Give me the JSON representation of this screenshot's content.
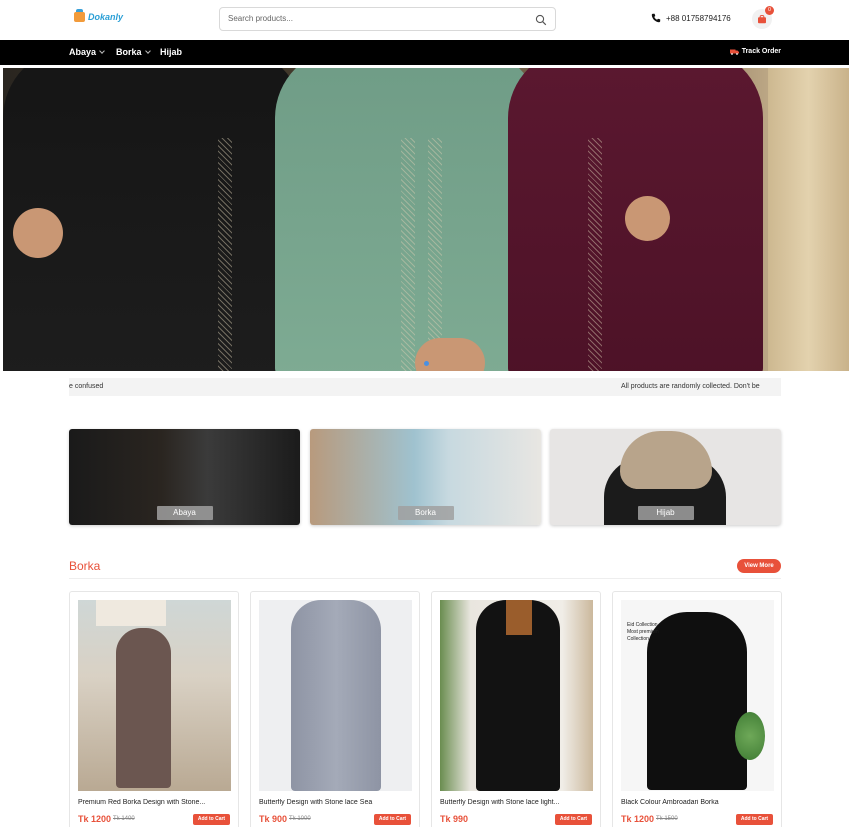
{
  "header": {
    "brand": "Dokanly",
    "search_placeholder": "Search products...",
    "phone": "+88 01758794176",
    "cart_count": "0"
  },
  "nav": {
    "items": [
      {
        "label": "Abaya",
        "has_dropdown": true
      },
      {
        "label": "Borka",
        "has_dropdown": true
      },
      {
        "label": "Hijab",
        "has_dropdown": false
      }
    ],
    "track_order": "Track Order"
  },
  "marquee": {
    "left_text": "e confused",
    "right_text": "All products are randomly collected. Don't be"
  },
  "categories": [
    {
      "label": "Abaya"
    },
    {
      "label": "Borka"
    },
    {
      "label": "Hijab"
    }
  ],
  "section": {
    "title": "Borka",
    "view_more": "View More"
  },
  "products": [
    {
      "name": "Premium Red Borka Design with Stone...",
      "price": "Tk 1200",
      "old_price": "Tk 1400",
      "add_label": "Add to Cart"
    },
    {
      "name": "Butterfly Design with Stone lace Sea",
      "price": "Tk 900",
      "old_price": "Tk 1000",
      "add_label": "Add to Cart"
    },
    {
      "name": "Butterfly Design with Stone lace light...",
      "price": "Tk 990",
      "old_price": "",
      "add_label": "Add to Cart"
    },
    {
      "name": "Black Colour Ambroadari Borka",
      "price": "Tk 1200",
      "old_price": "Tk 1500",
      "add_label": "Add to Cart",
      "image_caption": "Eid Collection\nMost premium\nCollection"
    }
  ],
  "colors": {
    "accent": "#e8513a",
    "nav_bg": "#000000",
    "brand": "#2a9fd6"
  }
}
